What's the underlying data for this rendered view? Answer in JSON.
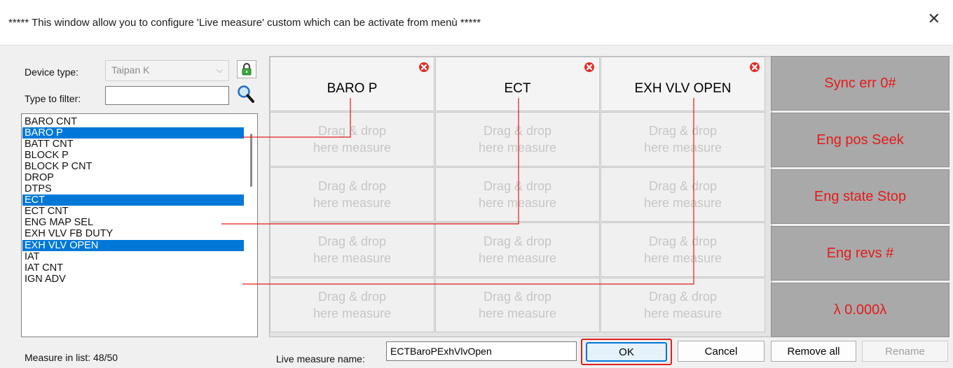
{
  "window": {
    "title": "***** This window allow you to configure 'Live measure' custom which can be activate from menù *****",
    "close_glyph": "✕"
  },
  "device": {
    "label": "Device type:",
    "value": "Taipan K",
    "dropdown_glyph": "⌵"
  },
  "filter": {
    "label": "Type to filter:",
    "value": ""
  },
  "measure_list": {
    "items": [
      {
        "label": "BARO CNT",
        "selected": false
      },
      {
        "label": "BARO P",
        "selected": true
      },
      {
        "label": "BATT CNT",
        "selected": false
      },
      {
        "label": "BLOCK P",
        "selected": false
      },
      {
        "label": "BLOCK P CNT",
        "selected": false
      },
      {
        "label": "DROP",
        "selected": false
      },
      {
        "label": "DTPS",
        "selected": false
      },
      {
        "label": "ECT",
        "selected": true
      },
      {
        "label": "ECT CNT",
        "selected": false
      },
      {
        "label": "ENG MAP SEL",
        "selected": false
      },
      {
        "label": "EXH VLV FB DUTY",
        "selected": false
      },
      {
        "label": "EXH VLV OPEN",
        "selected": true
      },
      {
        "label": "IAT",
        "selected": false
      },
      {
        "label": "IAT CNT",
        "selected": false
      },
      {
        "label": "IGN ADV",
        "selected": false
      }
    ],
    "count_text": "Measure in list: 48/50"
  },
  "grid": {
    "filled": [
      "BARO P",
      "ECT",
      "EXH VLV OPEN"
    ],
    "placeholder_line1": "Drag & drop",
    "placeholder_line2": "here measure",
    "empty_rows": 4
  },
  "status_boxes": [
    "Sync err 0#",
    "Eng pos Seek",
    "Eng state Stop",
    "Eng revs #",
    "λ 0.000λ"
  ],
  "colors": {
    "selection": "#0078d7",
    "status_text": "#e31c1c",
    "status_bg": "#a9a9a9",
    "connector": "#e31c1c"
  },
  "footer": {
    "name_label": "Live measure name:",
    "name_value": "ECTBaroPExhVlvOpen",
    "ok": "OK",
    "cancel": "Cancel",
    "remove_all": "Remove all",
    "rename": "Rename"
  }
}
